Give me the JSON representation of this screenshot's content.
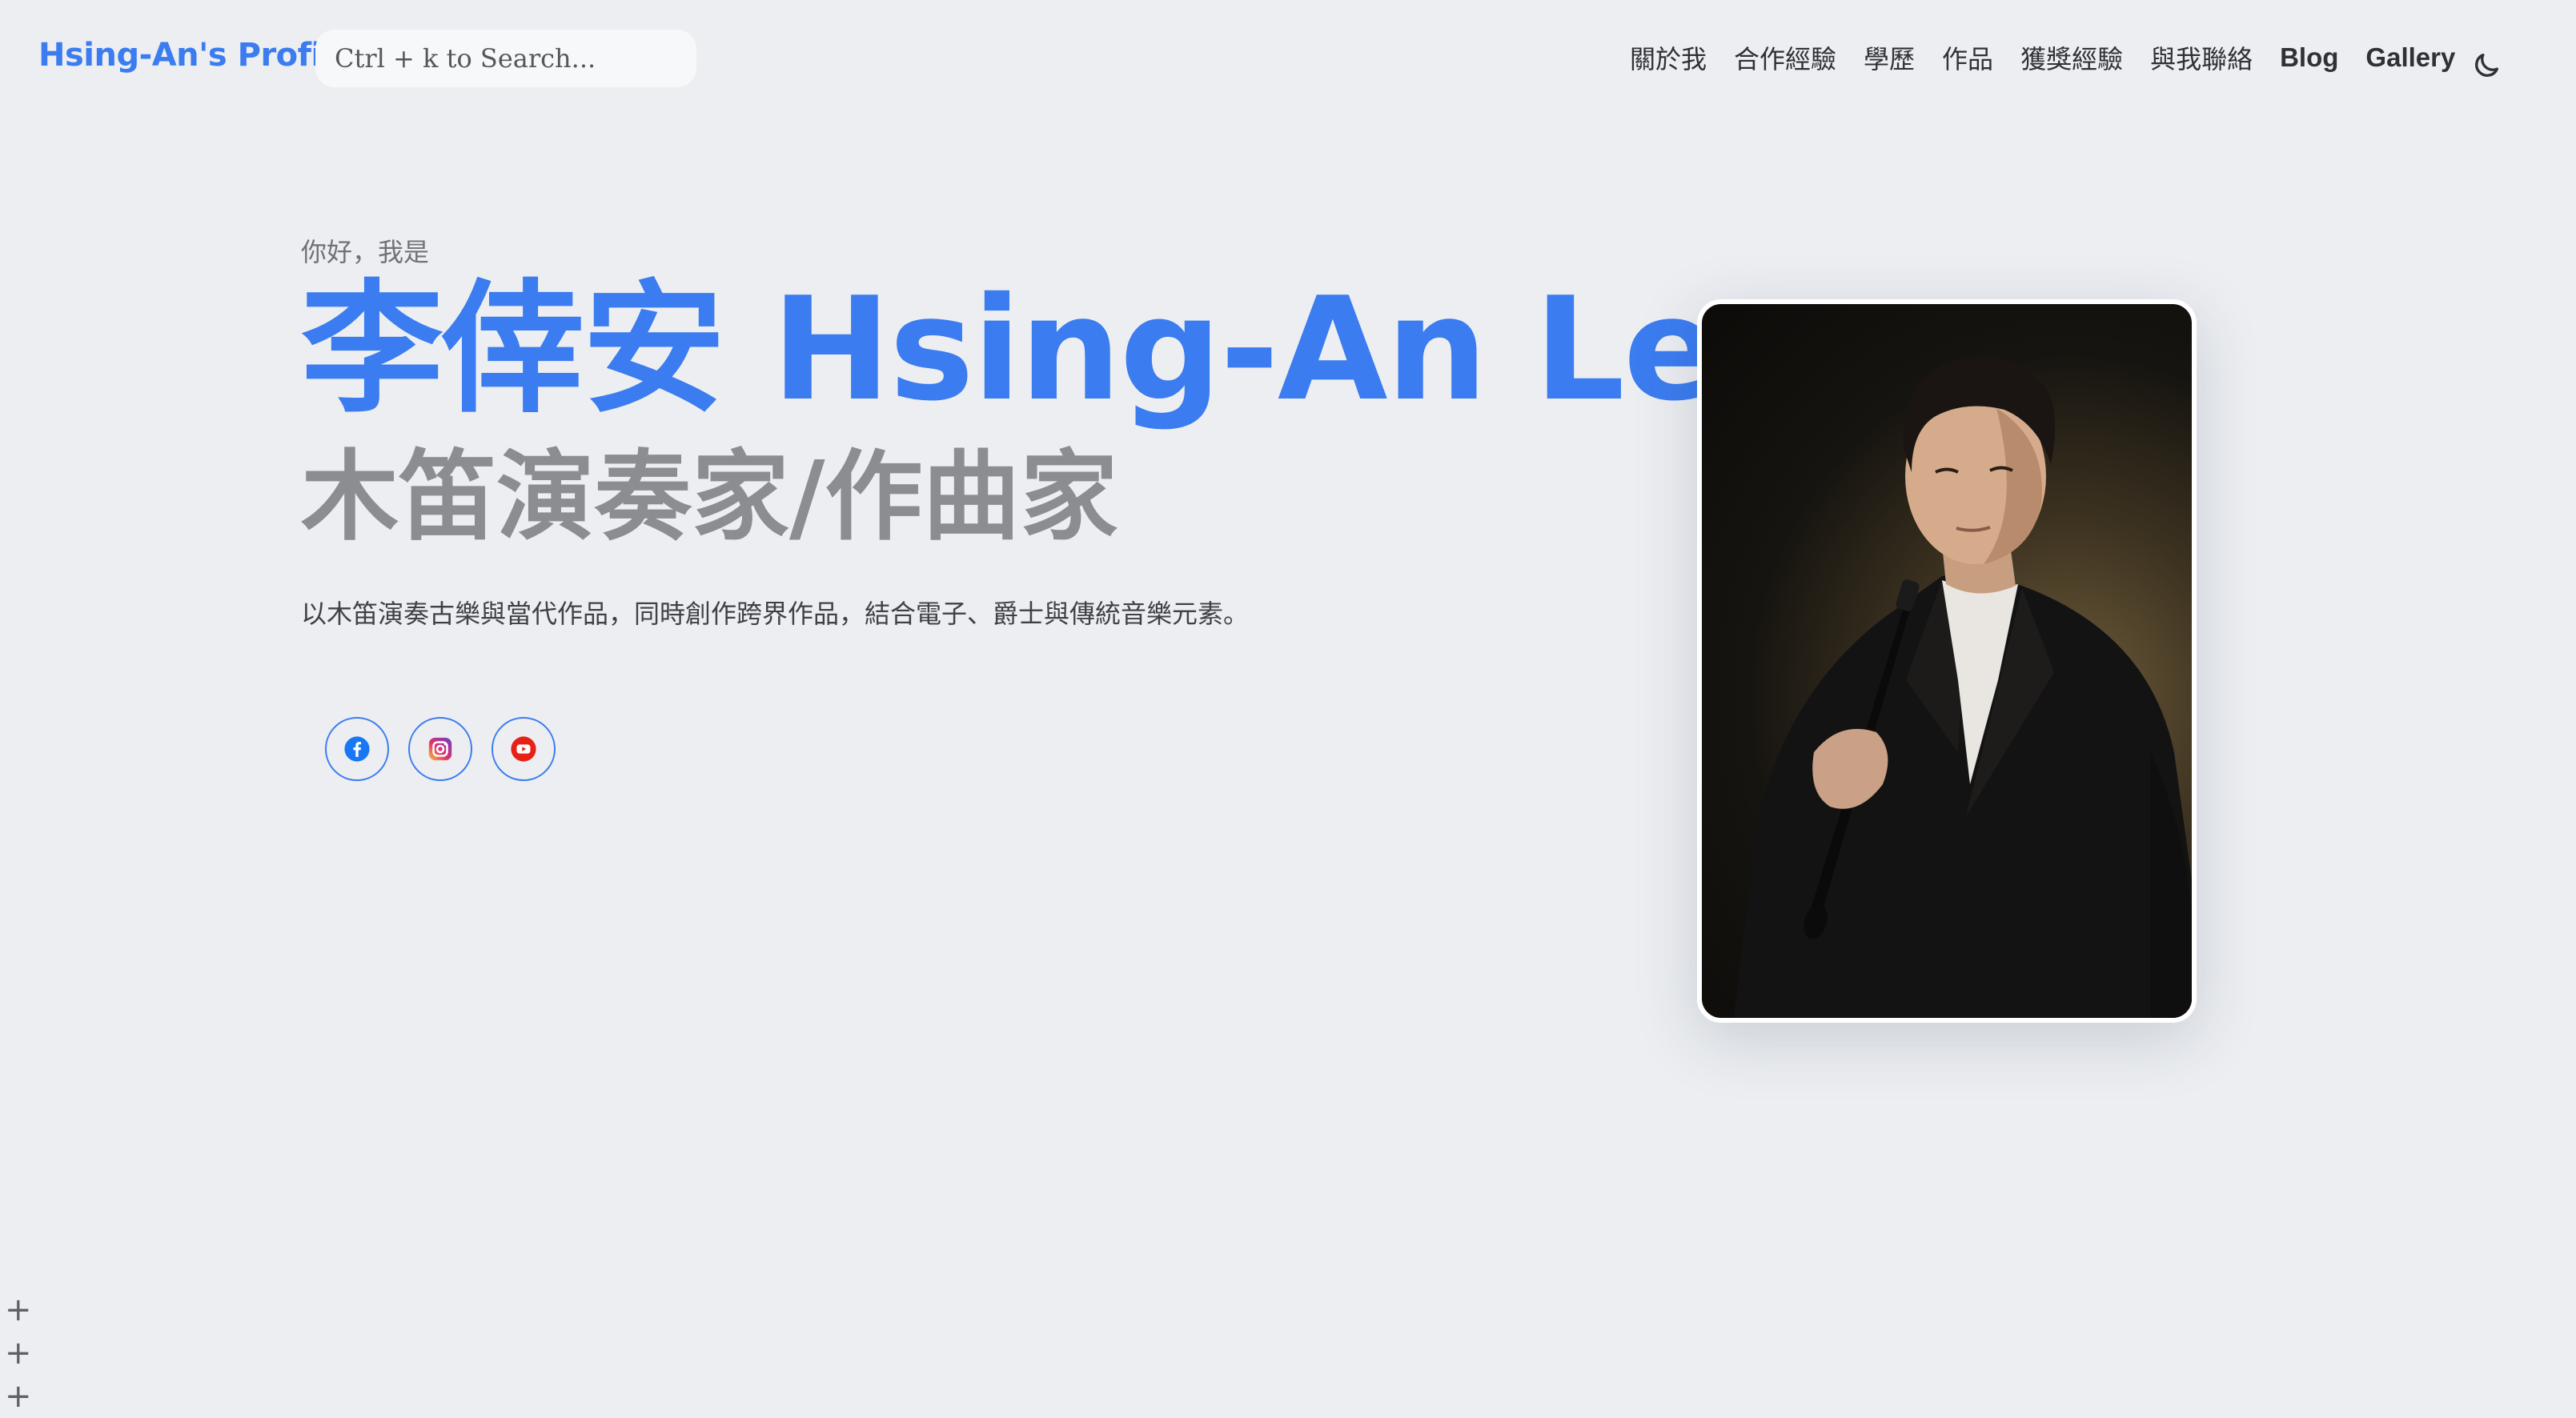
{
  "header": {
    "brand": "Hsing-An's Profile",
    "search_placeholder": "Ctrl + k to Search...",
    "nav": [
      "關於我",
      "合作經驗",
      "學歷",
      "作品",
      "獲獎經驗",
      "與我聯絡",
      "Blog",
      "Gallery"
    ],
    "theme_icon": "moon-icon"
  },
  "hero": {
    "greeting": "你好，我是",
    "name": "李倖安 Hsing-An Lee",
    "role": "木笛演奏家/作曲家",
    "description": "以木笛演奏古樂與當代作品，同時創作跨界作品，結合電子、爵士與傳統音樂元素。",
    "socials": [
      "facebook-icon",
      "instagram-icon",
      "youtube-icon"
    ]
  },
  "plus_marks": [
    "+",
    "+",
    "+"
  ],
  "colors": {
    "accent": "#3b7cf0",
    "background": "#eceef1",
    "subtitle": "#8b8d91"
  }
}
